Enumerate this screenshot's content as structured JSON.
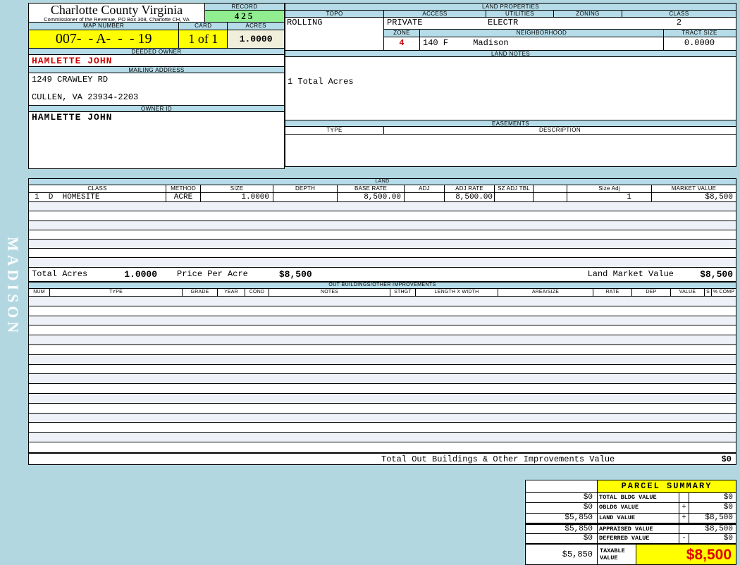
{
  "colors": {
    "page_bg": "#b2d7e0",
    "section_bar": "#b5dce8",
    "highlight_yellow": "#ffff00",
    "record_green": "#90ee90",
    "acres_cream": "#f0efdc",
    "alert_red": "#cc0000",
    "taxable_red": "#e00000"
  },
  "sidebar": {
    "watermark": "MADISON"
  },
  "header": {
    "county_title": "Charlotte County Virginia",
    "county_subtitle": "Commissioner of the Revenue, PO Box 308, Charlotte CH, VA",
    "record_label": "RECORD",
    "record_value": "425",
    "map_number_label": "MAP NUMBER",
    "map_number_value": "007-  - A-  -  - 19",
    "card_label": "CARD",
    "card_value": "1 of 1",
    "acres_label": "ACRES",
    "acres_value": "1.0000",
    "deeded_owner_label": "DEEDED OWNER",
    "deeded_owner_value": "HAMLETTE JOHN",
    "mailing_address_label": "MAILING ADDRESS",
    "mailing_address_line1": "1249 CRAWLEY RD",
    "mailing_address_line2": "CULLEN, VA 23934-2203",
    "owner_id_label": "OWNER ID",
    "owner_id_value": "HAMLETTE JOHN"
  },
  "land_properties": {
    "title": "LAND PROPERTIES",
    "topo_label": "TOPO",
    "topo": "ROLLING",
    "access_label": "ACCESS",
    "access": "PRIVATE",
    "utilities_label": "UTILITIES",
    "utilities": "ELECTR",
    "zoning_label": "ZONING",
    "zoning": "",
    "class_label": "CLASS",
    "class_value": "2",
    "zone_label": "ZONE",
    "zone_value": "4",
    "neighborhood_code": "140 F",
    "neighborhood_label": "NEIGHBORHOOD",
    "neighborhood": "Madison",
    "tract_size_label": "TRACT SIZE",
    "tract_size": "0.0000"
  },
  "land_notes": {
    "title": "LAND NOTES",
    "note": "1 Total Acres"
  },
  "easements": {
    "title": "EASEMENTS",
    "type_label": "TYPE",
    "description_label": "DESCRIPTION"
  },
  "land_table": {
    "title": "LAND",
    "headers": [
      "CLASS",
      "METHOD",
      "SIZE",
      "DEPTH",
      "BASE RATE",
      "ADJ",
      "ADJ RATE",
      "SZ ADJ TBL",
      "",
      "Size Adj",
      "MARKET VALUE"
    ],
    "row": {
      "class_value": "1  D  HOMESITE",
      "method": "ACRE",
      "size": "1.0000",
      "depth": "",
      "base_rate": "8,500.00",
      "adj": "",
      "adj_rate": "8,500.00",
      "sz_adj_tbl": "",
      "size_adj": "1",
      "market_value": "$8,500"
    },
    "totals": {
      "total_acres_label": "Total Acres",
      "total_acres": "1.0000",
      "price_per_acre_label": "Price Per Acre",
      "price_per_acre": "$8,500",
      "land_market_value_label": "Land Market Value",
      "land_market_value": "$8,500"
    }
  },
  "out_buildings": {
    "title": "OUT BUILDINGS/OTHER IMPROVEMENTS",
    "headers": [
      "NUM",
      "TYPE",
      "GRADE",
      "YEAR",
      "COND",
      "NOTES",
      "STHGT",
      "LENGTH X WIDTH",
      "AREA/SIZE",
      "RATE",
      "DEP",
      "VALUE",
      "S",
      "% COMP"
    ],
    "total_label": "Total Out Buildings & Other Improvements Value",
    "total_value": "$0"
  },
  "parcel_summary": {
    "title": "PARCEL SUMMARY",
    "rows": [
      {
        "prior": "$0",
        "label": "TOTAL BLDG VALUE",
        "op": "",
        "value": "$0"
      },
      {
        "prior": "$0",
        "label": "OBLDG VALUE",
        "op": "+",
        "value": "$0"
      },
      {
        "prior": "$5,850",
        "label": "LAND VALUE",
        "op": "+",
        "value": "$8,500"
      },
      {
        "prior": "$5,850",
        "label": "APPRAISED VALUE",
        "op": "",
        "value": "$8,500"
      },
      {
        "prior": "$0",
        "label": "DEFERRED VALUE",
        "op": "-",
        "value": "$0"
      }
    ],
    "taxable": {
      "prior": "$5,850",
      "label_line1": "TAXABLE",
      "label_line2": "VALUE",
      "value": "$8,500"
    }
  }
}
